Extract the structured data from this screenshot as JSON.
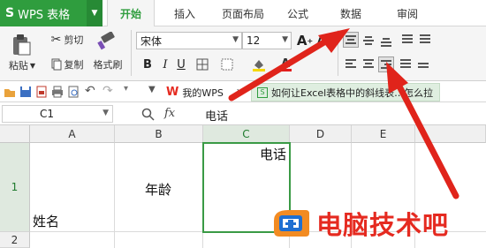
{
  "app": {
    "menu_label": "WPS 表格",
    "logo": "S"
  },
  "tabs": [
    {
      "label": "开始",
      "active": true
    },
    {
      "label": "插入",
      "active": false
    },
    {
      "label": "页面布局",
      "active": false
    },
    {
      "label": "公式",
      "active": false
    },
    {
      "label": "数据",
      "active": false
    },
    {
      "label": "审阅",
      "active": false
    }
  ],
  "ribbon": {
    "paste_label": "粘贴",
    "cut_label": "剪切",
    "copy_label": "复制",
    "format_painter_label": "格式刷",
    "font_name": "宋体",
    "font_size": "12",
    "bold": "B",
    "italic": "I",
    "underline": "U"
  },
  "quick_access": {
    "doc_tab_1": "我的WPS",
    "doc_tab_2": "如何让Excel表格中的斜线表…怎么拉"
  },
  "formula_bar": {
    "cell_ref": "C1",
    "fx": "fx",
    "value": "电话"
  },
  "sheet": {
    "columns": [
      "A",
      "B",
      "C",
      "D",
      "E"
    ],
    "rows": [
      "1",
      "2"
    ],
    "selected_column": "C",
    "selected_row": "1",
    "cells": {
      "A1": "姓名",
      "B1": "年龄",
      "C1": "电话"
    }
  },
  "watermark": {
    "text": "电脑技术吧"
  },
  "colors": {
    "accent": "#2f9d3e",
    "arrow": "#e0241b"
  }
}
